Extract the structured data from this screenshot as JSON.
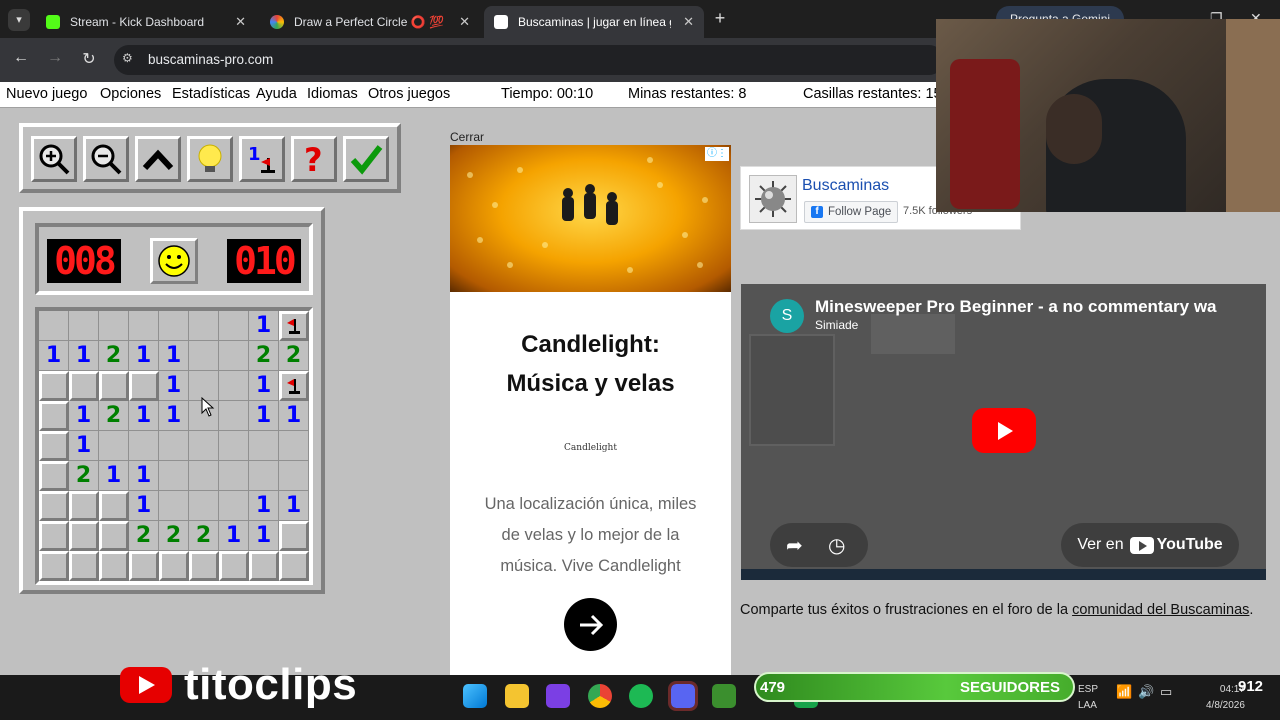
{
  "browser": {
    "tabs": [
      {
        "title": "Stream - Kick Dashboard",
        "icon": "kick-icon",
        "color": "#53fc18"
      },
      {
        "title": "Draw a Perfect Circle ⭕ 💯",
        "icon": "circle-icon",
        "color": "#f4b400"
      },
      {
        "title": "Buscaminas | jugar en línea gra",
        "icon": "mine-icon",
        "color": "#ffffff"
      }
    ],
    "gemini_label": "Pregunta a Gemini",
    "url": "buscaminas-pro.com"
  },
  "menu": {
    "items": [
      "Nuevo juego",
      "Opciones",
      "Estadísticas",
      "Ayuda",
      "Idiomas",
      "Otros juegos"
    ],
    "time_label": "Tiempo: 00:10",
    "mines_label": "Minas restantes: 8",
    "cells_label": "Casillas restantes: 15"
  },
  "toolbar": {
    "buttons": [
      "zoom-in-icon",
      "zoom-out-icon",
      "chevron-up-icon",
      "hint-bulb-icon",
      "flag-number-icon",
      "question-icon",
      "check-icon"
    ]
  },
  "game": {
    "mine_counter": "008",
    "timer": "010",
    "face": "smiley",
    "board": [
      [
        " ",
        " ",
        " ",
        " ",
        " ",
        " ",
        " ",
        "1",
        "F"
      ],
      [
        "1",
        "1",
        "2",
        "1",
        "1",
        " ",
        " ",
        "2",
        "2"
      ],
      [
        "#",
        "#",
        "#",
        "#",
        "1",
        " ",
        " ",
        "1",
        "F"
      ],
      [
        "#",
        "1",
        "2",
        "1",
        "1",
        " ",
        " ",
        "1",
        "1"
      ],
      [
        "#",
        "1",
        " ",
        " ",
        " ",
        " ",
        " ",
        " ",
        " "
      ],
      [
        "#",
        "2",
        "1",
        "1",
        " ",
        " ",
        " ",
        " ",
        " "
      ],
      [
        "#",
        "#",
        "#",
        "1",
        " ",
        " ",
        " ",
        "1",
        "1"
      ],
      [
        "#",
        "#",
        "#",
        "2",
        "2",
        "2",
        "1",
        "1",
        "#"
      ],
      [
        "#",
        "#",
        "#",
        "#",
        "#",
        "#",
        "#",
        "#",
        "#"
      ]
    ]
  },
  "ad": {
    "close_label": "Cerrar",
    "headline_line1": "Candlelight:",
    "headline_line2": "Música y velas",
    "brand": "Candlelight",
    "body": "Una localización única, miles de velas y lo mejor de la música. Vive Candlelight"
  },
  "facebook": {
    "page_name": "Buscaminas",
    "follow_label": "Follow Page",
    "followers": "7.5K followers"
  },
  "video": {
    "channel_initial": "S",
    "title": "Minesweeper Pro Beginner - a no commentary wa",
    "channel": "Simiade",
    "watch_on_label": "Ver en",
    "watch_on_brand": "YouTube"
  },
  "community": {
    "text": "Comparte tus éxitos o frustraciones en el foro de la ",
    "link": "comunidad del Buscaminas",
    "suffix": "."
  },
  "stream_overlay": {
    "brand_text": "titoclips",
    "followers_count": "479",
    "followers_label": "SEGUIDORES",
    "goal": "912"
  },
  "taskbar": {
    "lang_top": "ESP",
    "lang_bottom": "LAA",
    "time": "04:17",
    "date": "4/8/2026",
    "icons": [
      "windows-start-icon",
      "file-explorer-icon",
      "clapper-icon",
      "chrome-icon",
      "spotify-icon",
      "discord-icon",
      "minecraft-icon",
      "green-app-icon"
    ]
  }
}
